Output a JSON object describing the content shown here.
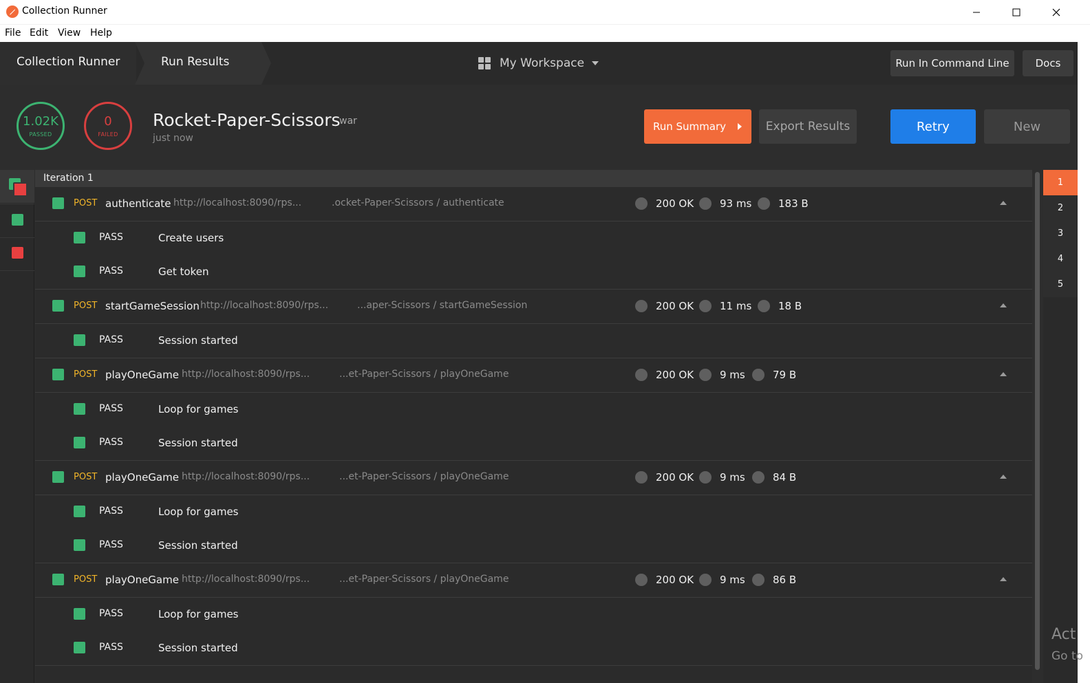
{
  "window": {
    "title": "Collection Runner",
    "controls": {
      "minimize": "minimize-icon",
      "maximize": "maximize-icon",
      "close": "close-icon"
    }
  },
  "menu": [
    "File",
    "Edit",
    "View",
    "Help"
  ],
  "header": {
    "breadcrumb": [
      "Collection Runner",
      "Run Results"
    ],
    "workspace": "My Workspace",
    "cmd_button": "Run In Command Line",
    "docs_button": "Docs"
  },
  "summary": {
    "passed_count": "1.02K",
    "passed_label": "PASSED",
    "failed_count": "0",
    "failed_label": "FAILED",
    "collection_name": "Rocket-Paper-Scissors",
    "environment": "war",
    "time": "just now",
    "run_summary_button": "Run Summary",
    "export_button": "Export Results",
    "retry_button": "Retry",
    "new_button": "New"
  },
  "iteration": {
    "label": "Iteration 1",
    "requests": [
      {
        "method": "POST",
        "name": "authenticate",
        "url": "http://localhost:8090/rps...",
        "path": ".ocket-Paper-Scissors / authenticate",
        "status": "200 OK",
        "time": "93 ms",
        "size": "183 B",
        "tests": [
          {
            "result": "PASS",
            "name": "Create users"
          },
          {
            "result": "PASS",
            "name": "Get token"
          }
        ]
      },
      {
        "method": "POST",
        "name": "startGameSession",
        "url": "http://localhost:8090/rps...",
        "path": "...aper-Scissors / startGameSession",
        "status": "200 OK",
        "time": "11 ms",
        "size": "18 B",
        "tests": [
          {
            "result": "PASS",
            "name": "Session started"
          }
        ]
      },
      {
        "method": "POST",
        "name": "playOneGame",
        "url": "http://localhost:8090/rps...",
        "path": "...et-Paper-Scissors / playOneGame",
        "status": "200 OK",
        "time": "9 ms",
        "size": "79 B",
        "tests": [
          {
            "result": "PASS",
            "name": "Loop for games"
          },
          {
            "result": "PASS",
            "name": "Session started"
          }
        ]
      },
      {
        "method": "POST",
        "name": "playOneGame",
        "url": "http://localhost:8090/rps...",
        "path": "...et-Paper-Scissors / playOneGame",
        "status": "200 OK",
        "time": "9 ms",
        "size": "84 B",
        "tests": [
          {
            "result": "PASS",
            "name": "Loop for games"
          },
          {
            "result": "PASS",
            "name": "Session started"
          }
        ]
      },
      {
        "method": "POST",
        "name": "playOneGame",
        "url": "http://localhost:8090/rps...",
        "path": "...et-Paper-Scissors / playOneGame",
        "status": "200 OK",
        "time": "9 ms",
        "size": "86 B",
        "tests": [
          {
            "result": "PASS",
            "name": "Loop for games"
          },
          {
            "result": "PASS",
            "name": "Session started"
          }
        ]
      }
    ]
  },
  "iteration_nav": [
    "1",
    "2",
    "3",
    "4",
    "5"
  ],
  "watermark": {
    "line1": "Act",
    "line2": "Go to"
  },
  "colors": {
    "accent": "#f26b3a",
    "pass": "#3cb371",
    "fail": "#d83f3f",
    "primary": "#1f7ee8",
    "method": "#f0b429"
  }
}
